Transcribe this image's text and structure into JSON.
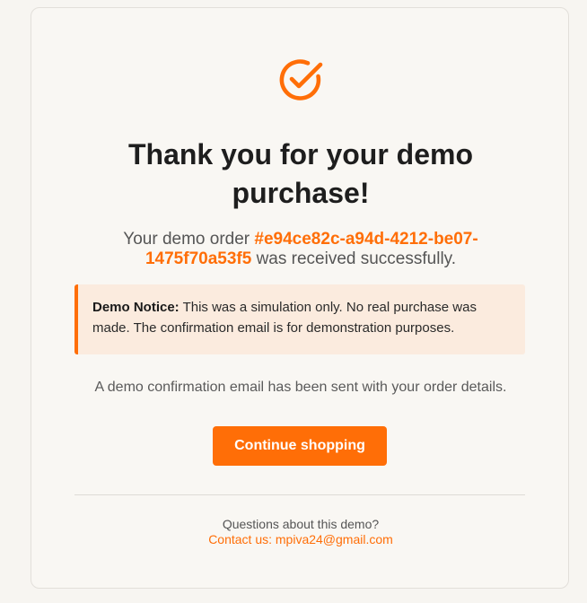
{
  "confirmation": {
    "icon": "check-circle-icon",
    "title": "Thank you for your demo purchase!",
    "order_prefix": "Your demo order ",
    "order_id": "#e94ce82c-a94d-4212-be07-1475f70a53f5",
    "order_suffix": " was received successfully.",
    "notice_label": "Demo Notice:",
    "notice_text": " This was a simulation only. No real purchase was made. The confirmation email is for demonstration purposes.",
    "email_sent": "A demo confirmation email has been sent with your order details.",
    "continue_label": "Continue shopping"
  },
  "footer": {
    "questions": "Questions about this demo?",
    "contact_prefix": "Contact us: ",
    "contact_email": "mpiva24@gmail.com"
  },
  "colors": {
    "accent": "#ff6e07",
    "notice_bg": "#fbebde",
    "card_bg": "#f9f7f3",
    "title": "#1e1e1e"
  }
}
